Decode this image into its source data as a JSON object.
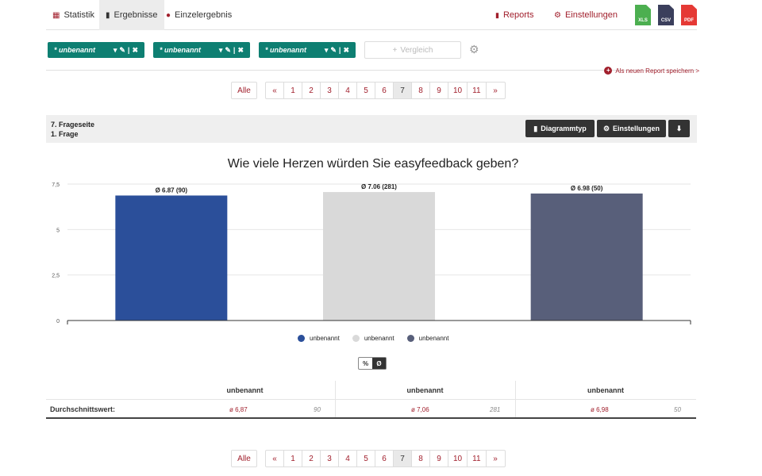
{
  "nav": {
    "tabs": [
      {
        "label": "Statistik",
        "icon": "table-icon"
      },
      {
        "label": "Ergebnisse",
        "icon": "bar-chart-icon"
      },
      {
        "label": "Einzelergebnis",
        "icon": "user-icon"
      }
    ],
    "active_tab": "Ergebnisse",
    "reports_label": "Reports",
    "settings_label": "Einstellungen",
    "exports": [
      "XLS",
      "CSV",
      "PDF"
    ]
  },
  "filters": {
    "chips": [
      "* unbenannt",
      "* unbenannt",
      "* unbenannt"
    ],
    "compare_label": "Vergleich",
    "save_report_label": "Als neuen Report speichern >"
  },
  "pagination": {
    "all_label": "Alle",
    "pages": [
      "«",
      "1",
      "2",
      "3",
      "4",
      "5",
      "6",
      "7",
      "8",
      "9",
      "10",
      "11",
      "»"
    ],
    "active": "7"
  },
  "question": {
    "page_label": "7. Frageseite",
    "question_label": "1. Frage",
    "chart_type_button": "Diagrammtyp",
    "settings_button": "Einstellungen"
  },
  "chart_data": {
    "type": "bar",
    "title": "Wie viele Herzen würden Sie easyfeedback geben?",
    "categories": [
      "unbenannt",
      "unbenannt",
      "unbenannt"
    ],
    "values": [
      6.87,
      7.06,
      6.98
    ],
    "counts": [
      90,
      281,
      50
    ],
    "data_labels": [
      "Ø 6.87 (90)",
      "Ø 7.06 (281)",
      "Ø 6.98 (50)"
    ],
    "colors": [
      "#2b4f9a",
      "#d9d9d9",
      "#585f7a"
    ],
    "ylim": [
      0,
      7.5
    ],
    "yticks": [
      "0",
      "2,5",
      "5",
      "7,5"
    ],
    "grid": true,
    "legend": "bottom"
  },
  "toggle": {
    "percent": "%",
    "average": "Ø"
  },
  "table": {
    "columns": [
      "unbenannt",
      "unbenannt",
      "unbenannt"
    ],
    "row_label": "Durchschnittswert:",
    "averages": [
      "ø 6,87",
      "ø 7,06",
      "ø 6,98"
    ],
    "counts": [
      "90",
      "281",
      "50"
    ]
  }
}
